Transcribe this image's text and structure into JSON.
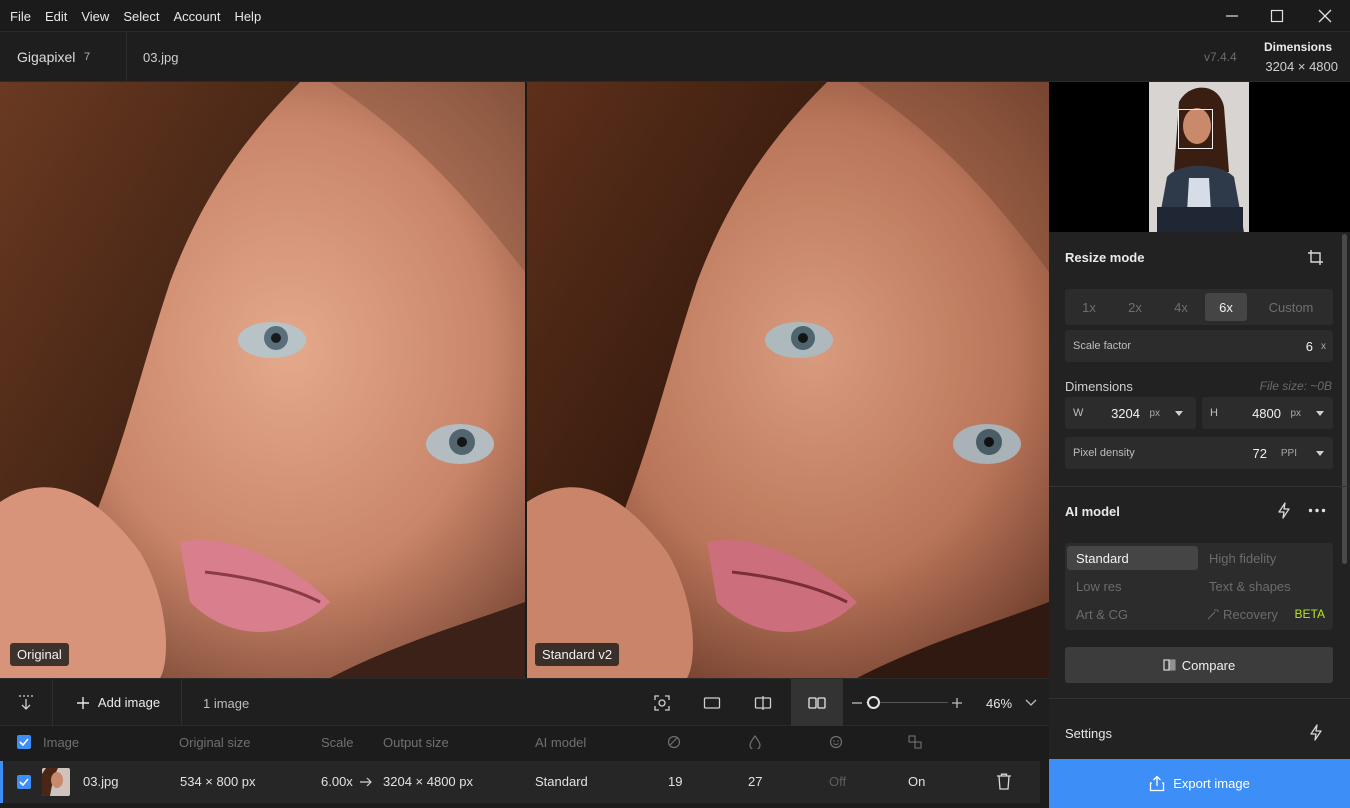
{
  "menu": [
    "File",
    "Edit",
    "View",
    "Select",
    "Account",
    "Help"
  ],
  "app": {
    "name": "Gigapixel",
    "version_badge": "7",
    "file_name": "03.jpg",
    "version": "v7.4.4"
  },
  "header_dimensions": {
    "label": "Dimensions",
    "value": "3204 × 4800"
  },
  "preview": {
    "left_label": "Original",
    "right_label": "Standard v2"
  },
  "toolbar": {
    "add_image": "Add image",
    "image_count": "1 image",
    "zoom": "46%"
  },
  "table": {
    "headers": [
      "Image",
      "Original size",
      "Scale",
      "Output size",
      "AI model"
    ],
    "row": {
      "name": "03.jpg",
      "original_size": "534 × 800 px",
      "scale": "6.00x",
      "output_size": "3204 × 4800 px",
      "ai_model": "Standard",
      "col1": "19",
      "col2": "27",
      "col3": "Off",
      "col4": "On"
    }
  },
  "resize": {
    "title": "Resize mode",
    "options": [
      "1x",
      "2x",
      "4x",
      "6x",
      "Custom"
    ],
    "selected": "6x",
    "scale_factor_label": "Scale factor",
    "scale_factor_value": "6",
    "scale_factor_unit": "x",
    "dimensions_label": "Dimensions",
    "file_size": "File size: ~0B",
    "w_label": "W",
    "w_value": "3204",
    "w_unit": "px",
    "h_label": "H",
    "h_value": "4800",
    "h_unit": "px",
    "density_label": "Pixel density",
    "density_value": "72",
    "density_unit": "PPI"
  },
  "ai_model": {
    "title": "AI model",
    "models": [
      "Standard",
      "High fidelity",
      "Low res",
      "Text & shapes",
      "Art & CG",
      "Recovery"
    ],
    "selected": "Standard",
    "beta": "BETA",
    "compare": "Compare"
  },
  "settings": {
    "title": "Settings"
  },
  "export": {
    "label": "Export image"
  },
  "colors": {
    "accent": "#3e8ef7",
    "beta": "#b6e61e"
  }
}
